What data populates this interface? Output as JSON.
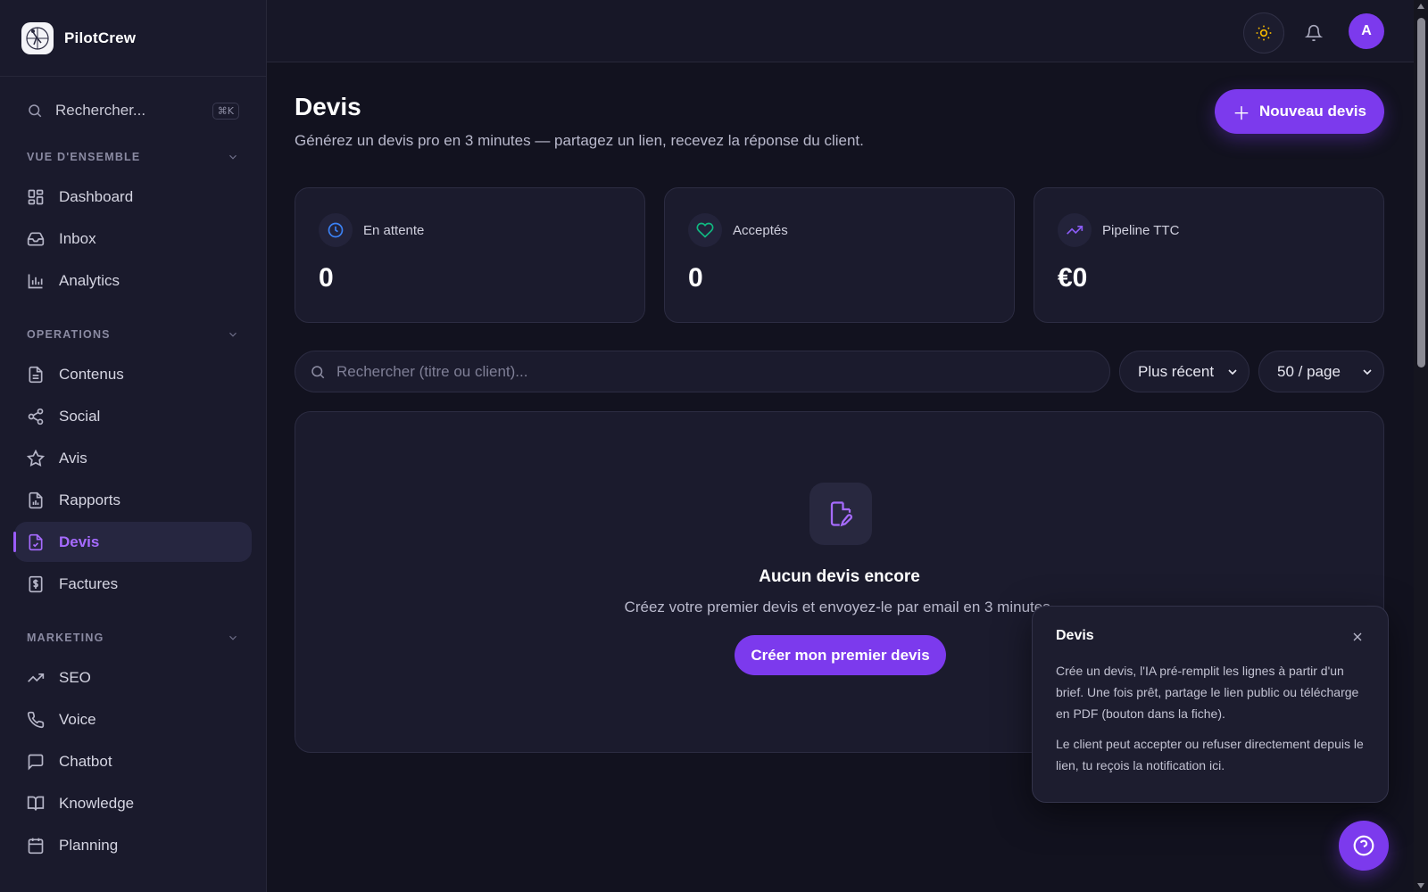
{
  "app": {
    "name": "PilotCrew"
  },
  "sidebar": {
    "search": {
      "label": "Rechercher...",
      "shortcut": "⌘K"
    },
    "sections": [
      {
        "label": "VUE D'ENSEMBLE",
        "items": [
          {
            "label": "Dashboard",
            "icon": "dashboard-icon"
          },
          {
            "label": "Inbox",
            "icon": "inbox-icon"
          },
          {
            "label": "Analytics",
            "icon": "analytics-icon"
          }
        ]
      },
      {
        "label": "OPERATIONS",
        "items": [
          {
            "label": "Contenus",
            "icon": "document-icon"
          },
          {
            "label": "Social",
            "icon": "share-icon"
          },
          {
            "label": "Avis",
            "icon": "star-icon"
          },
          {
            "label": "Rapports",
            "icon": "report-icon"
          },
          {
            "label": "Devis",
            "icon": "quote-icon",
            "active": true
          },
          {
            "label": "Factures",
            "icon": "invoice-icon"
          }
        ]
      },
      {
        "label": "MARKETING",
        "items": [
          {
            "label": "SEO",
            "icon": "trend-icon"
          },
          {
            "label": "Voice",
            "icon": "phone-icon"
          },
          {
            "label": "Chatbot",
            "icon": "chat-icon"
          },
          {
            "label": "Knowledge",
            "icon": "book-icon"
          },
          {
            "label": "Planning",
            "icon": "calendar-icon"
          }
        ]
      }
    ]
  },
  "topbar": {
    "avatar_initial": "A"
  },
  "page": {
    "title": "Devis",
    "subtitle": "Générez un devis pro en 3 minutes — partagez un lien, recevez la réponse du client.",
    "new_button": "Nouveau devis"
  },
  "stats": [
    {
      "label": "En attente",
      "value": "0",
      "icon": "clock-icon",
      "color": "#3b82f6"
    },
    {
      "label": "Acceptés",
      "value": "0",
      "icon": "heart-icon",
      "color": "#10b981"
    },
    {
      "label": "Pipeline TTC",
      "value": "€0",
      "icon": "trending-up-icon",
      "color": "#8b5cf6"
    }
  ],
  "filters": {
    "search_placeholder": "Rechercher (titre ou client)...",
    "sort_value": "Plus récent",
    "page_size_value": "50 / page"
  },
  "empty": {
    "title": "Aucun devis encore",
    "subtitle": "Créez votre premier devis et envoyez-le par email en 3 minutes.",
    "button": "Créer mon premier devis"
  },
  "popover": {
    "title": "Devis",
    "body1": "Crée un devis, l'IA pré-remplit les lignes à partir d'un brief. Une fois prêt, partage le lien public ou télécharge en PDF (bouton dans la fiche).",
    "body2": "Le client peut accepter ou refuser directement depuis le lien, tu reçois la notification ici."
  },
  "colors": {
    "accent": "#7c3aed",
    "accent_text": "#a66bff",
    "background": "#12121f",
    "surface": "#1b1b2d"
  }
}
